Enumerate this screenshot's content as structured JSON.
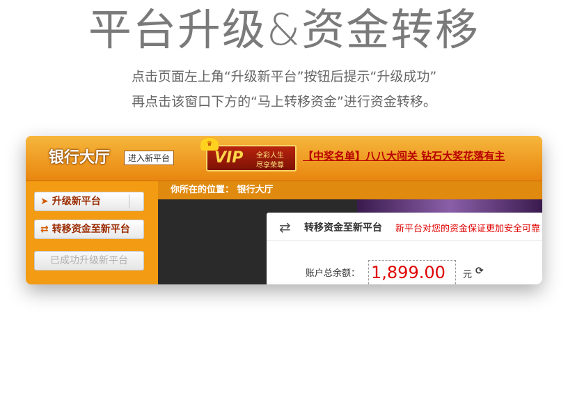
{
  "header": {
    "title": "平台升级&资金转移",
    "desc_line1": "点击页面左上角“升级新平台”按钮后提示“升级成功”",
    "desc_line2": "再点击该窗口下方的“马上转移资金”进行资金转移。"
  },
  "topbar": {
    "hall": "银行大厅",
    "enter_new": "进入新平台",
    "vip_badge": "VIP",
    "vip_sub1": "全彩人生",
    "vip_sub2": "尽享荣尊",
    "ticker": "【中奖名单】八八大闯关 钻石大奖花落有主"
  },
  "sidebar": {
    "upgrade": "升级新平台",
    "transfer": "转移资金至新平台",
    "upgraded": "已成功升级新平台"
  },
  "location": {
    "text": "你所在的位置： 银行大厅"
  },
  "panel": {
    "title": "转移资金至新平台",
    "note": "新平台对您的资金保证更加安全可靠",
    "balance_label": "账户总余额：",
    "balance": "1,899.00",
    "unit": "元"
  },
  "icons": {
    "cursor": "cursor-icon",
    "swap": "swap-arrows-icon",
    "refresh": "refresh-icon"
  }
}
